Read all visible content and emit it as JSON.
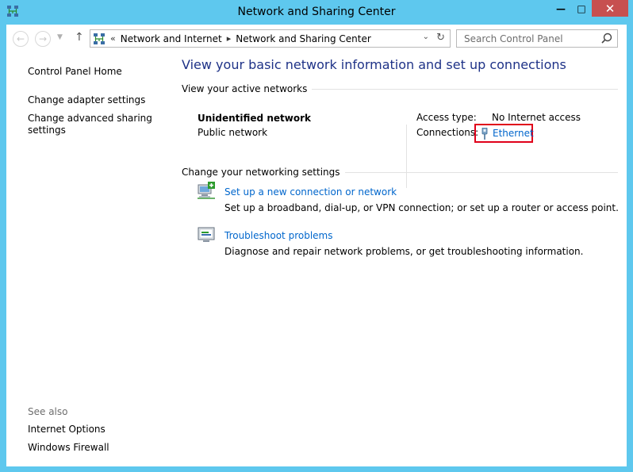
{
  "window": {
    "title": "Network and Sharing Center"
  },
  "titlebar": {
    "minimize_glyph": "—",
    "maximize_glyph": "□",
    "close_glyph": "✕"
  },
  "address": {
    "overflow": "«",
    "crumbs": [
      "Network and Internet",
      "Network and Sharing Center"
    ],
    "separator": "▸"
  },
  "search": {
    "placeholder": "Search Control Panel"
  },
  "left_pane": {
    "home": "Control Panel Home",
    "links": [
      "Change adapter settings",
      "Change advanced sharing settings"
    ],
    "see_also_heading": "See also",
    "see_also": [
      "Internet Options",
      "Windows Firewall"
    ]
  },
  "main": {
    "title": "View your basic network information and set up connections",
    "active_section": "View your active networks",
    "network": {
      "name": "Unidentified network",
      "type": "Public network",
      "access_label": "Access type:",
      "access_value": "No Internet access",
      "connections_label": "Connections:",
      "connection": "Ethernet"
    },
    "change_section": "Change your networking settings",
    "tasks": [
      {
        "link": "Set up a new connection or network",
        "desc": "Set up a broadband, dial-up, or VPN connection; or set up a router or access point.",
        "icon": "network-setup-icon"
      },
      {
        "link": "Troubleshoot problems",
        "desc": "Diagnose and repair network problems, or get troubleshooting information.",
        "icon": "troubleshoot-icon"
      }
    ]
  },
  "colors": {
    "titlebar": "#5ec8ee",
    "close": "#c75050",
    "link": "#0066cc",
    "title": "#1e3287",
    "highlight": "#e0001a"
  }
}
